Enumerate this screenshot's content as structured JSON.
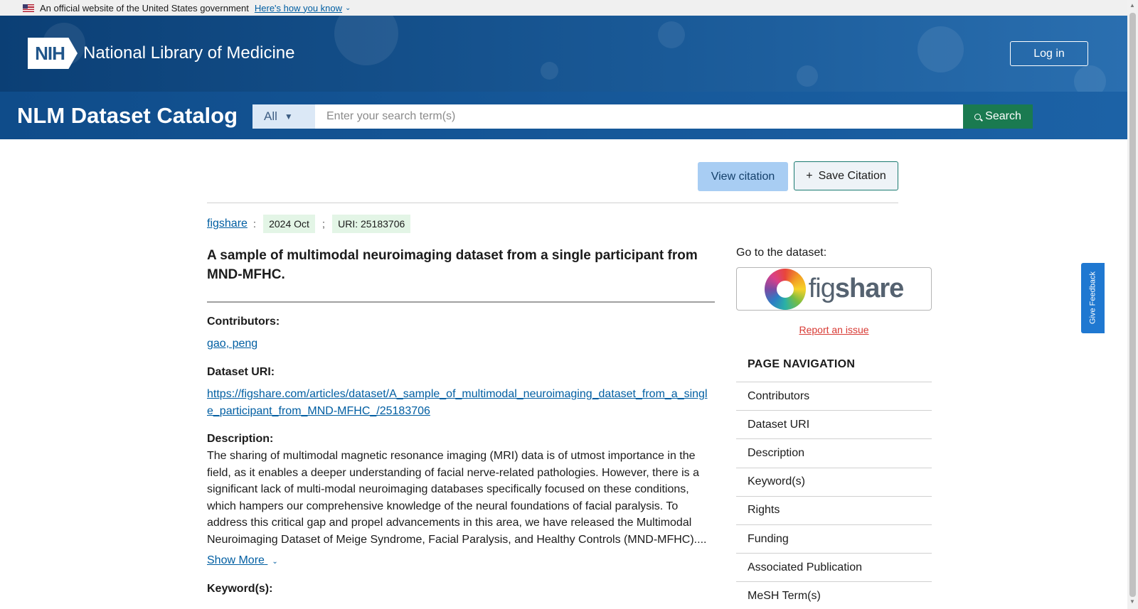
{
  "gov_banner": {
    "text": "An official website of the United States government",
    "link": "Here's how you know"
  },
  "header": {
    "logo_text": "NIH",
    "org_name": "National Library of Medicine",
    "login_label": "Log in"
  },
  "search": {
    "catalog_title": "NLM Dataset Catalog",
    "scope": "All",
    "placeholder": "Enter your search term(s)",
    "button_label": "Search"
  },
  "actions": {
    "view_citation": "View citation",
    "save_citation": "Save Citation"
  },
  "meta": {
    "source": "figshare",
    "source_sep": ":",
    "date": "2024 Oct",
    "date_sep": ";",
    "uri": "URI: 25183706"
  },
  "dataset": {
    "title": "A sample of multimodal neuroimaging dataset from a single participant from MND-MFHC.",
    "contributors_label": "Contributors:",
    "contributor": "gao, peng",
    "uri_label": "Dataset URI:",
    "uri": "https://figshare.com/articles/dataset/A_sample_of_multimodal_neuroimaging_dataset_from_a_single_participant_from_MND-MFHC_/25183706",
    "description_label": "Description:",
    "description": "The sharing of multimodal magnetic resonance imaging (MRI) data is of utmost importance in the field, as it enables a deeper understanding of facial nerve-related pathologies. However, there is a significant lack of multi-modal neuroimaging databases specifically focused on these conditions, which hampers our comprehensive knowledge of the neural foundations of facial paralysis. To address this critical gap and propel advancements in this area, we have released the Multimodal Neuroimaging Dataset of Meige Syndrome, Facial Paralysis, and Healthy Controls (MND-MFHC)....",
    "show_more": "Show More",
    "keywords_label": "Keyword(s):"
  },
  "sidebar": {
    "goto_label": "Go to the dataset:",
    "repo_logo_light": "fig",
    "repo_logo_bold": "share",
    "report_issue": "Report an issue",
    "nav_title": "PAGE NAVIGATION",
    "nav_items": [
      "Contributors",
      "Dataset URI",
      "Description",
      "Keyword(s)",
      "Rights",
      "Funding",
      "Associated Publication",
      "MeSH Term(s)"
    ]
  },
  "feedback": {
    "label": "Give Feedback"
  },
  "colors": {
    "header_blue": "#0b3f75",
    "search_green": "#1a7a50",
    "link_blue": "#005ea2",
    "report_red": "#d83933",
    "pill_green": "#e3f5e6"
  }
}
